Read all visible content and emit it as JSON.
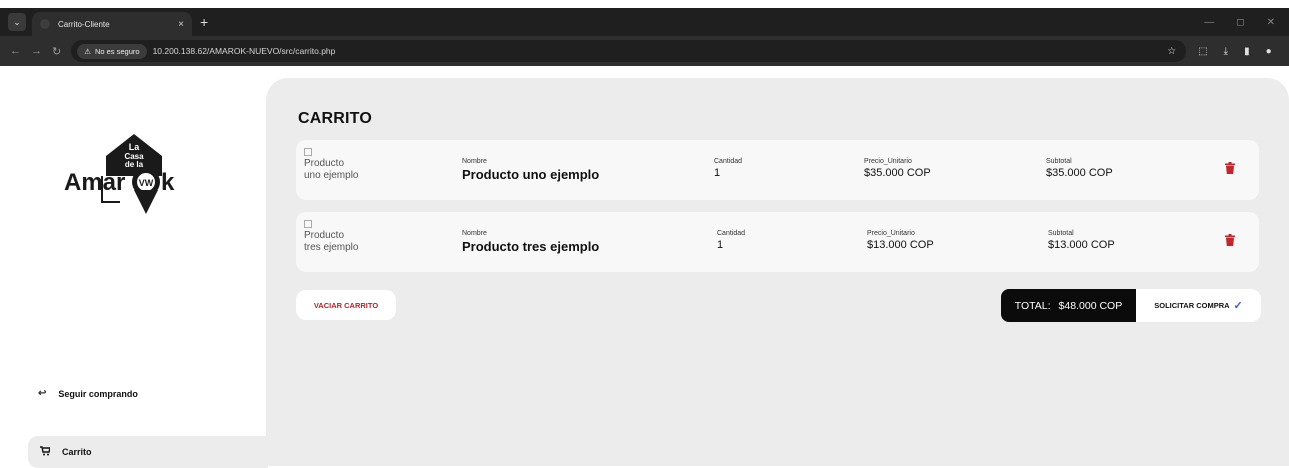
{
  "browser": {
    "tab_title": "Carrito-Cliente",
    "tab_close": "×",
    "new_tab": "+",
    "security_label": "No es seguro",
    "url": "10.200.138.62/AMAROK-NUEVO/src/carrito.php"
  },
  "sidebar": {
    "logo_text": "Amarok",
    "logo_top": "La Casa de la",
    "continue_label": "Seguir comprando",
    "cart_label": "Carrito"
  },
  "cart": {
    "title": "CARRITO",
    "items": [
      {
        "image_alt": "Producto uno ejemplo",
        "name_label": "Nombre",
        "name": "Producto uno ejemplo",
        "qty_label": "Cantidad",
        "qty": "1",
        "price_label": "Precio_Unitario",
        "price": "$35.000 COP",
        "subtotal_label": "Subtotal",
        "subtotal": "$35.000 COP"
      },
      {
        "image_alt": "Producto tres ejemplo",
        "name_label": "Nombre",
        "name": "Producto tres ejemplo",
        "qty_label": "Cantidad",
        "qty": "1",
        "price_label": "Precio_Unitario",
        "price": "$13.000 COP",
        "subtotal_label": "Subtotal",
        "subtotal": "$13.000 COP"
      }
    ],
    "empty_button": "VACIAR CARRITO",
    "total_label": "TOTAL:",
    "total_value": "$48.000 COP",
    "checkout_button": "SOLICITAR COMPRA",
    "checkout_icon": "✓"
  },
  "colors": {
    "accent_red": "#b4232a",
    "dark": "#0b0b0b"
  }
}
